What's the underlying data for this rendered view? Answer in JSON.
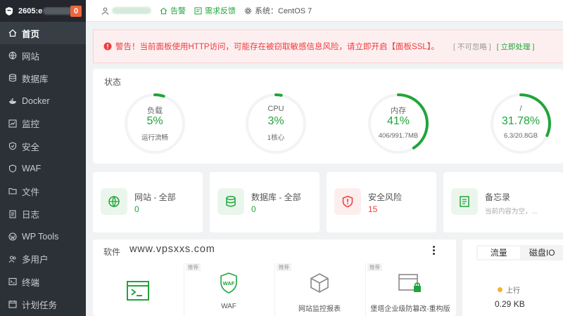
{
  "sidebar": {
    "host": "2605:e",
    "badge": "0",
    "items": [
      {
        "label": "首页",
        "icon": "home-icon"
      },
      {
        "label": "网站",
        "icon": "globe-icon"
      },
      {
        "label": "数据库",
        "icon": "database-icon"
      },
      {
        "label": "Docker",
        "icon": "docker-icon"
      },
      {
        "label": "监控",
        "icon": "monitor-icon"
      },
      {
        "label": "安全",
        "icon": "shield-icon"
      },
      {
        "label": "WAF",
        "icon": "waf-shield-icon"
      },
      {
        "label": "文件",
        "icon": "folder-icon"
      },
      {
        "label": "日志",
        "icon": "log-icon"
      },
      {
        "label": "WP Tools",
        "icon": "wordpress-icon"
      },
      {
        "label": "多用户",
        "icon": "users-icon"
      },
      {
        "label": "终端",
        "icon": "terminal-icon"
      },
      {
        "label": "计划任务",
        "icon": "calendar-icon"
      }
    ]
  },
  "topbar": {
    "alarm": "告警",
    "feedback": "需求反馈",
    "system": "系统：CentOS 7"
  },
  "warning": {
    "text": "警告！当前面板使用HTTP访问，可能存在被窃取敏感信息风险，请立即开启【面板SSL】。",
    "ignore": "[ 不可忽略 ]",
    "handle": "[ 立即处理 ]"
  },
  "status": {
    "title": "状态",
    "gauges": [
      {
        "label": "负载",
        "value": "5%",
        "sub": "运行流畅",
        "percent": 5
      },
      {
        "label": "CPU",
        "value": "3%",
        "sub": "1核心",
        "percent": 3
      },
      {
        "label": "内存",
        "value": "41%",
        "sub": "406/991.7MB",
        "percent": 41
      },
      {
        "label": "/",
        "value": "31.78%",
        "sub": "6.3/20.8GB",
        "percent": 31.78
      }
    ]
  },
  "overview": [
    {
      "label": "网站 - 全部",
      "value": "0",
      "icon": "globe-icon"
    },
    {
      "label": "数据库 - 全部",
      "value": "0",
      "icon": "database-icon"
    },
    {
      "label": "安全风险",
      "value": "15",
      "icon": "risk-shield-icon"
    },
    {
      "label": "备忘录",
      "value": "当前内容为空，...",
      "icon": "memo-icon"
    }
  ],
  "software": {
    "title": "软件",
    "watermark": "www.vpsxxs.com",
    "tiles": [
      {
        "tag": "",
        "name": ""
      },
      {
        "tag": "推荐",
        "name": "WAF"
      },
      {
        "tag": "推荐",
        "name": "网站监控报表"
      },
      {
        "tag": "推荐",
        "name": "堡塔企业级防篡改-重构版"
      }
    ]
  },
  "traffic": {
    "tabs": [
      "流量",
      "磁盘IO"
    ],
    "up_label": "上行",
    "up_value": "0.29 KB"
  },
  "colors": {
    "accent": "#20a53a",
    "danger": "#ef3c3c",
    "sidebar": "#2c3138"
  }
}
